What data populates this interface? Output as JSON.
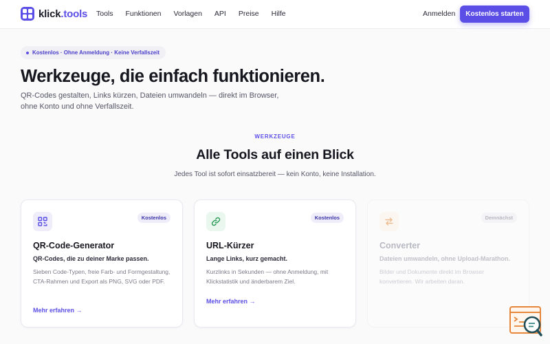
{
  "header": {
    "logo_word": "klick",
    "logo_dot": ".",
    "logo_suffix": "tools",
    "nav": [
      "Tools",
      "Funktionen",
      "Vorlagen",
      "API",
      "Preise",
      "Hilfe"
    ],
    "login": "Anmelden",
    "cta": "Kostenlos starten"
  },
  "hero": {
    "pill": "Kostenlos · Ohne Anmeldung · Keine Verfallszeit",
    "title": "Werkzeuge, die einfach funktionieren.",
    "subtitle": "QR-Codes gestalten, Links kürzen, Dateien umwandeln — direkt im Browser, ohne Konto und ohne Verfallszeit."
  },
  "section": {
    "eyebrow": "WERKZEUGE",
    "title": "Alle Tools auf einen Blick",
    "subtitle": "Jedes Tool ist sofort einsatzbereit — kein Konto, keine Installation."
  },
  "cards": [
    {
      "icon": "qr-code-icon",
      "badge": "Kostenlos",
      "title": "QR-Code-Generator",
      "tagline": "QR-Codes, die zu deiner Marke passen.",
      "description": "Sieben Code-Typen, freie Farb- und Formgestaltung, CTA-Rahmen und Export als PNG, SVG oder PDF.",
      "link": "Mehr erfahren →"
    },
    {
      "icon": "link-icon",
      "badge": "Kostenlos",
      "title": "URL-Kürzer",
      "tagline": "Lange Links, kurz gemacht.",
      "description": "Kurzlinks in Sekunden — ohne Anmeldung, mit Klickstatistik und änderbarem Ziel.",
      "link": "Mehr erfahren →"
    },
    {
      "icon": "convert-arrows-icon",
      "badge": "Demnächst",
      "title": "Converter",
      "tagline": "Dateien umwandeln, ohne Upload-Marathon.",
      "description": "Bilder und Dokumente direkt im Browser konvertieren. Wir arbeiten daran."
    }
  ],
  "colors": {
    "accent": "#5b4ee6",
    "text": "#16161f",
    "muted": "#555566",
    "background": "#fafafb"
  },
  "widget": {
    "icon": "search-assistant-icon"
  }
}
